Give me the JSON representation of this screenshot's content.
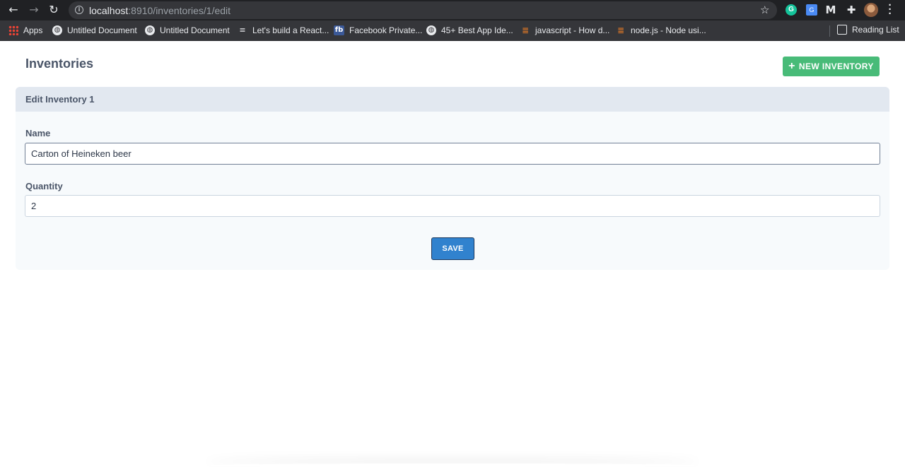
{
  "browser": {
    "url_host": "localhost",
    "url_path": ":8910/inventories/1/edit",
    "bookmarks": [
      {
        "label": "Apps",
        "icon": "apps-grid-icon"
      },
      {
        "label": "Untitled Document",
        "icon": "globe-icon"
      },
      {
        "label": "Untitled Document",
        "icon": "globe-icon"
      },
      {
        "label": "Let's build a React...",
        "icon": "lines-icon"
      },
      {
        "label": "Facebook Private...",
        "icon": "facebook-icon"
      },
      {
        "label": "45+ Best App Ide...",
        "icon": "globe-icon"
      },
      {
        "label": "javascript - How d...",
        "icon": "stackoverflow-icon"
      },
      {
        "label": "node.js - Node usi...",
        "icon": "stackoverflow-icon"
      }
    ],
    "reading_list": "Reading List",
    "extensions": {
      "grammarly": "G",
      "translate": "G"
    }
  },
  "page": {
    "title": "Inventories",
    "new_button": "NEW INVENTORY",
    "card_title": "Edit Inventory 1",
    "name_label": "Name",
    "name_value": "Carton of Heineken beer",
    "quantity_label": "Quantity",
    "quantity_value": "2",
    "save_button": "SAVE"
  },
  "colors": {
    "accent_green": "#48bb78",
    "save_blue": "#3182ce",
    "card_header": "#e2e8f0",
    "text": "#4a5568"
  }
}
